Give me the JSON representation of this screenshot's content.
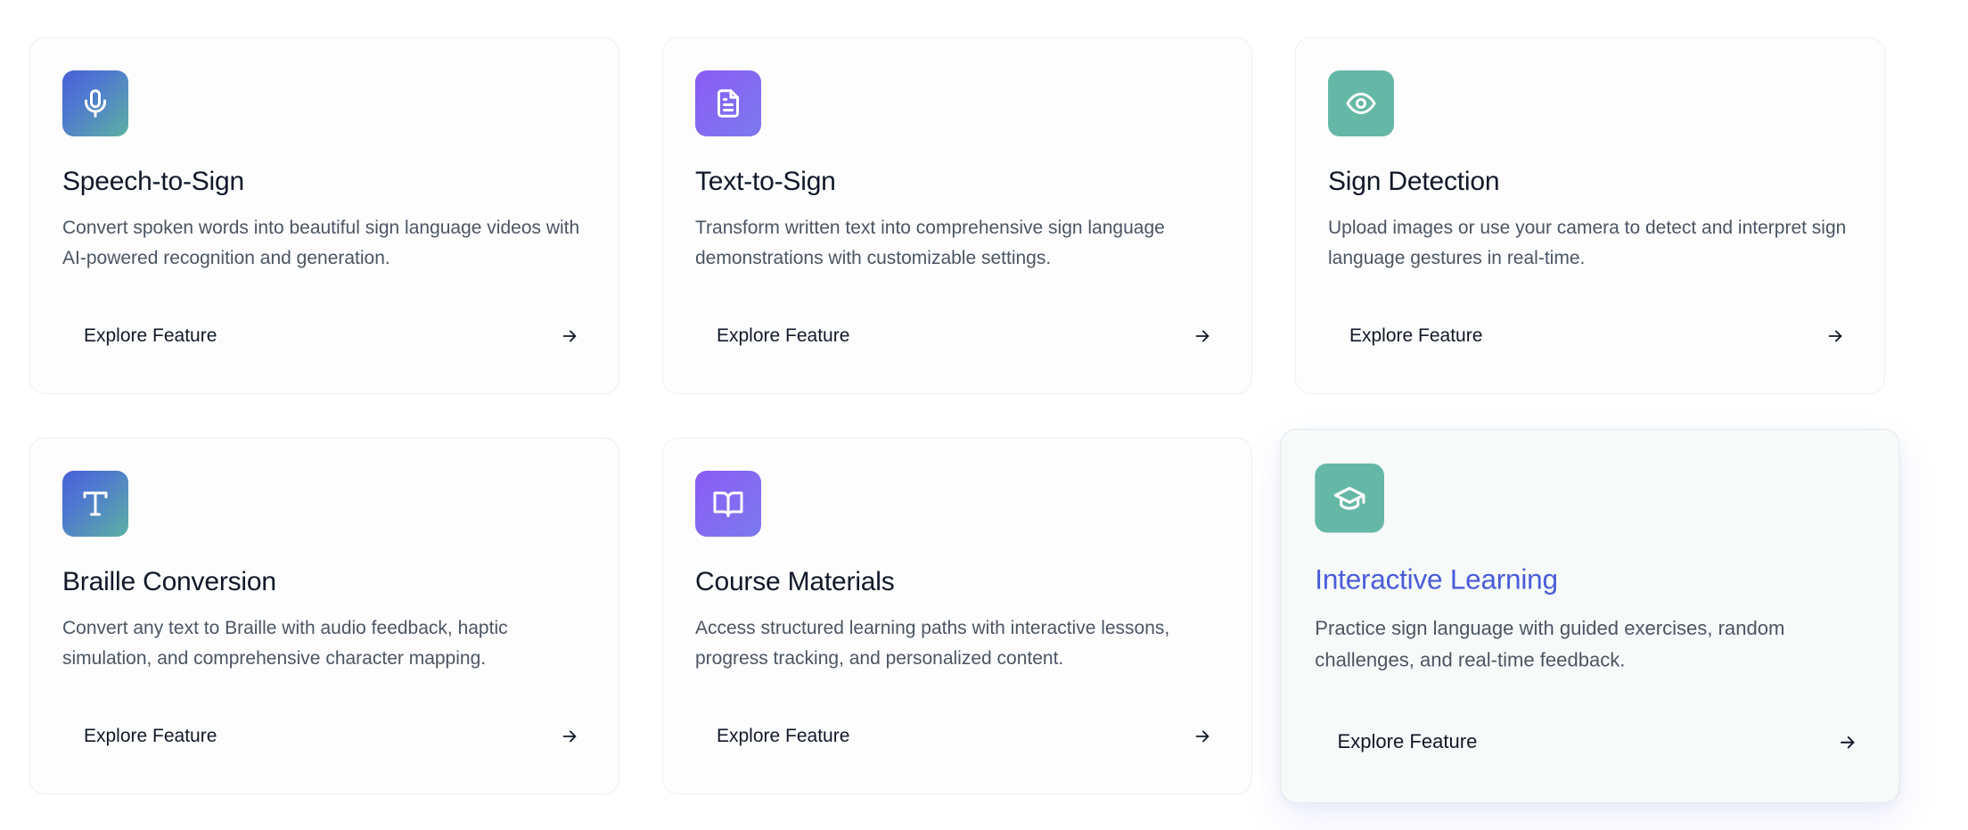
{
  "features": [
    {
      "title": "Speech-to-Sign",
      "description": "Convert spoken words into beautiful sign language videos with AI-powered recognition and generation.",
      "cta": "Explore Feature",
      "icon": "microphone-icon"
    },
    {
      "title": "Text-to-Sign",
      "description": "Transform written text into comprehensive sign language demonstrations with customizable settings.",
      "cta": "Explore Feature",
      "icon": "document-icon"
    },
    {
      "title": "Sign Detection",
      "description": "Upload images or use your camera to detect and interpret sign language gestures in real-time.",
      "cta": "Explore Feature",
      "icon": "eye-icon"
    },
    {
      "title": "Braille Conversion",
      "description": "Convert any text to Braille with audio feedback, haptic simulation, and comprehensive character mapping.",
      "cta": "Explore Feature",
      "icon": "type-icon"
    },
    {
      "title": "Course Materials",
      "description": "Access structured learning paths with interactive lessons, progress tracking, and personalized content.",
      "cta": "Explore Feature",
      "icon": "book-open-icon"
    },
    {
      "title": "Interactive Learning",
      "description": "Practice sign language with guided exercises, random challenges, and real-time feedback.",
      "cta": "Explore Feature",
      "icon": "graduation-cap-icon"
    }
  ],
  "colors": {
    "blue_teal_gradient": [
      "#4a5fd6",
      "#5cb0a4"
    ],
    "violet_gradient": [
      "#8b5cf6",
      "#7c79ee"
    ],
    "teal": "#66b8a6",
    "hover_title": "#4a5bd8"
  }
}
